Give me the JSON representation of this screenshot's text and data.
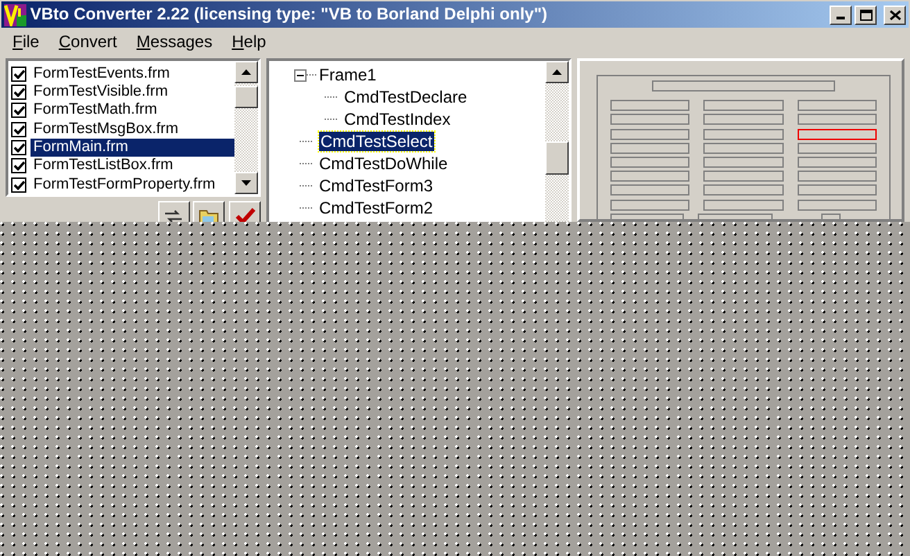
{
  "window": {
    "title": "VBto Converter 2.22 (licensing type: \"VB to Borland Delphi only\")"
  },
  "menu": [
    {
      "label": "File"
    },
    {
      "label": "Convert"
    },
    {
      "label": "Messages"
    },
    {
      "label": "Help"
    }
  ],
  "file_list": [
    {
      "label": "FormTestEvents.frm",
      "checked": true,
      "selected": false
    },
    {
      "label": "FormTestVisible.frm",
      "checked": true,
      "selected": false
    },
    {
      "label": "FormTestMath.frm",
      "checked": true,
      "selected": false
    },
    {
      "label": "FormTestMsgBox.frm",
      "checked": true,
      "selected": false
    },
    {
      "label": "FormMain.frm",
      "checked": true,
      "selected": true
    },
    {
      "label": "FormTestListBox.frm",
      "checked": true,
      "selected": false
    },
    {
      "label": "FormTestFormProperty.frm",
      "checked": true,
      "selected": false
    }
  ],
  "toolbar": [
    {
      "kind": "swap"
    },
    {
      "kind": "folder"
    },
    {
      "kind": "check"
    }
  ],
  "tree": [
    {
      "label": "Frame1",
      "expanded": true,
      "selected": false,
      "children": [
        {
          "label": "CmdTestDeclare",
          "selected": false
        },
        {
          "label": "CmdTestIndex",
          "selected": false
        }
      ]
    },
    {
      "label": "CmdTestSelect",
      "selected": true
    },
    {
      "label": "CmdTestDoWhile",
      "selected": false
    },
    {
      "label": "CmdTestForm3",
      "selected": false
    },
    {
      "label": "CmdTestForm2",
      "selected": false
    }
  ],
  "designer": {
    "rows": [
      [
        {
          "kind": "field",
          "selected": false
        },
        {
          "kind": "field",
          "selected": false
        },
        {
          "kind": "field",
          "selected": false
        }
      ],
      [
        {
          "kind": "field",
          "selected": false
        },
        {
          "kind": "field",
          "selected": false
        },
        {
          "kind": "field",
          "selected": false
        }
      ],
      [
        {
          "kind": "field",
          "selected": false
        },
        {
          "kind": "field",
          "selected": false
        },
        {
          "kind": "field",
          "selected": true
        }
      ],
      [
        {
          "kind": "field",
          "selected": false
        },
        {
          "kind": "field",
          "selected": false
        },
        {
          "kind": "field",
          "selected": false
        }
      ],
      [
        {
          "kind": "field",
          "selected": false
        },
        {
          "kind": "field",
          "selected": false
        },
        {
          "kind": "field",
          "selected": false
        }
      ],
      [
        {
          "kind": "field",
          "selected": false
        },
        {
          "kind": "field",
          "selected": false
        },
        {
          "kind": "field",
          "selected": false
        }
      ],
      [
        {
          "kind": "field",
          "selected": false
        },
        {
          "kind": "field",
          "selected": false
        },
        {
          "kind": "field",
          "selected": false
        }
      ],
      [
        {
          "kind": "field",
          "selected": false
        },
        {
          "kind": "field",
          "selected": false
        },
        {
          "kind": "field",
          "selected": false
        }
      ],
      [
        {
          "kind": "field",
          "selected": false
        },
        {
          "kind": "field",
          "selected": false
        },
        {
          "kind": "small",
          "selected": false
        }
      ]
    ]
  }
}
